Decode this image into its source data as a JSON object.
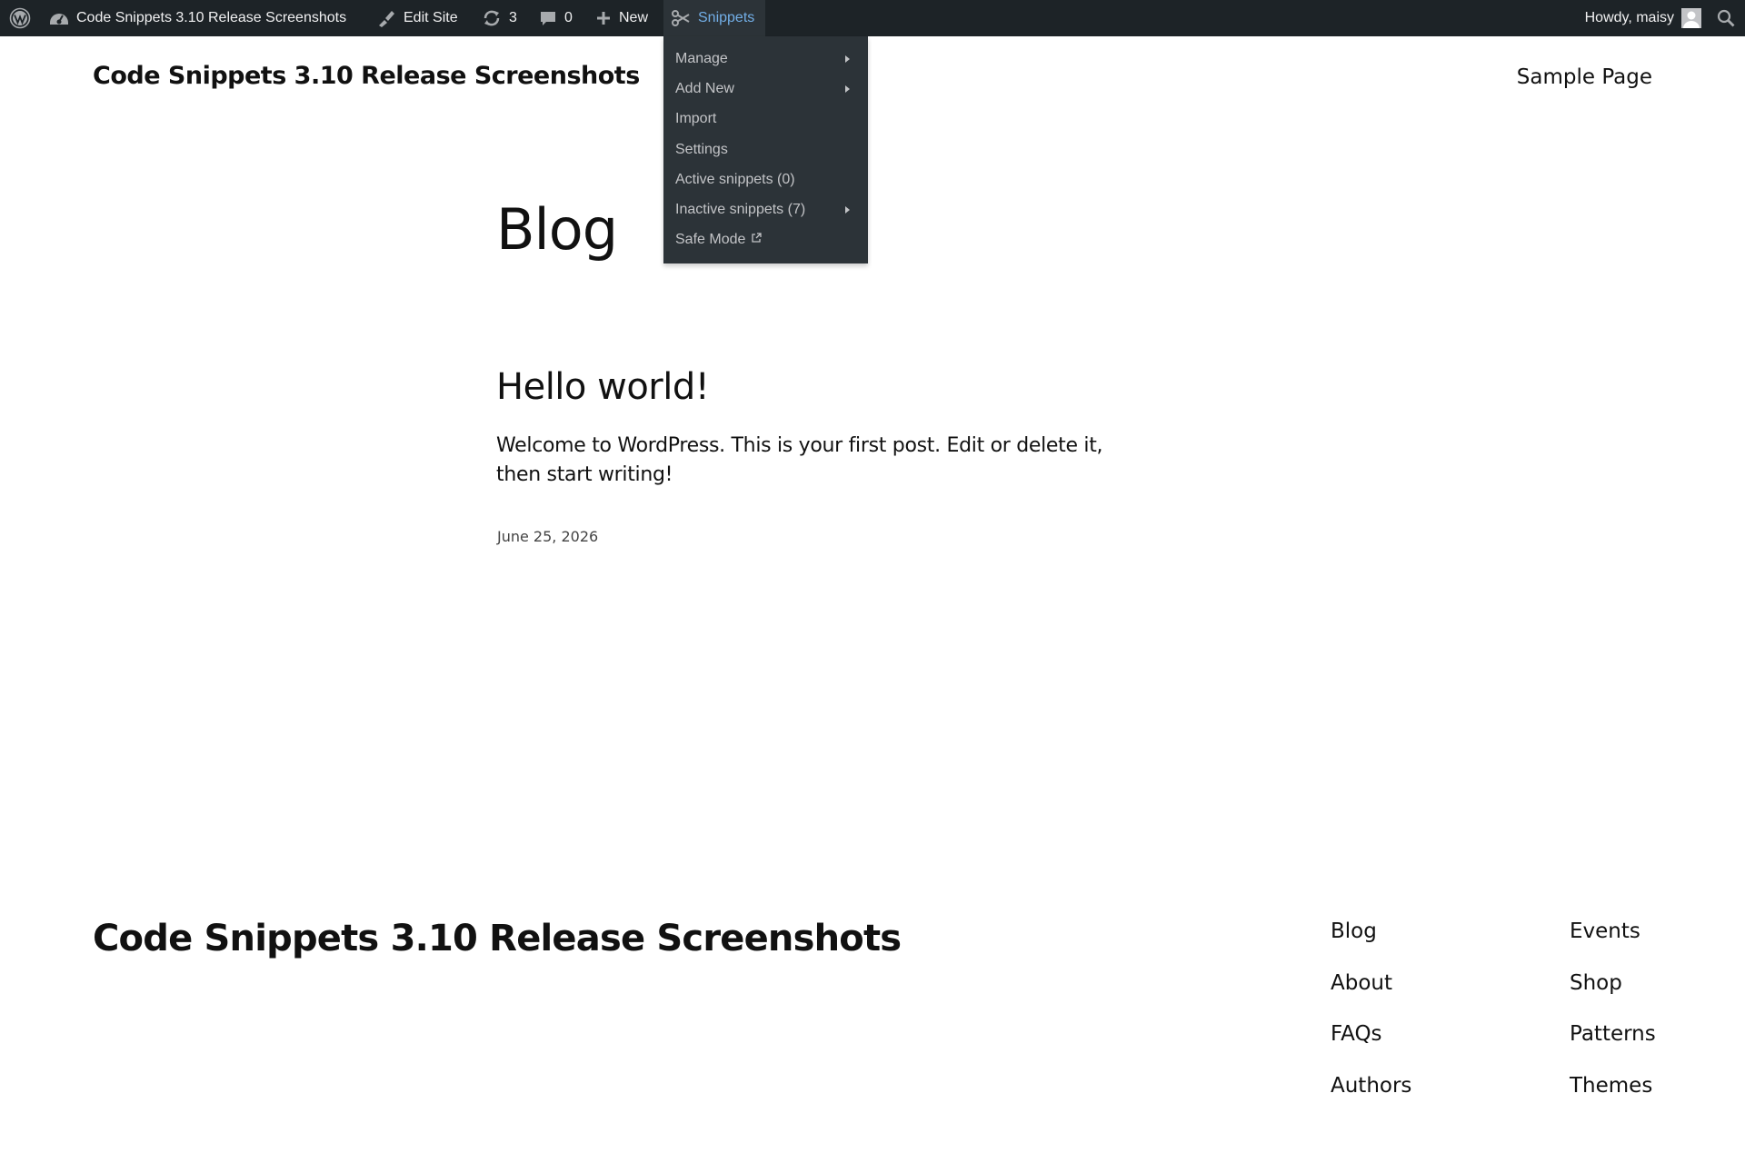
{
  "admin_bar": {
    "site_name": "Code Snippets 3.10 Release Screenshots",
    "edit_site": "Edit Site",
    "updates_count": "3",
    "comments_count": "0",
    "new_label": "New",
    "snippets_label": "Snippets",
    "howdy": "Howdy, maisy"
  },
  "snippets_menu": {
    "items": [
      {
        "label": "Manage"
      },
      {
        "label": "Add New"
      },
      {
        "label": "Import"
      },
      {
        "label": "Settings"
      },
      {
        "label": "Active snippets (0)"
      },
      {
        "label": "Inactive snippets (7)"
      },
      {
        "label": "Safe Mode"
      }
    ]
  },
  "header": {
    "site_title": "Code Snippets 3.10 Release Screenshots",
    "nav": [
      "Sample Page"
    ]
  },
  "main": {
    "heading": "Blog",
    "post": {
      "title": "Hello world!",
      "excerpt": "Welcome to WordPress. This is your first post. Edit or delete it, then start writing!",
      "date": "June 25, 2026"
    }
  },
  "footer": {
    "title": "Code Snippets 3.10 Release Screenshots",
    "col1": [
      "Blog",
      "About",
      "FAQs",
      "Authors"
    ],
    "col2": [
      "Events",
      "Shop",
      "Patterns",
      "Themes"
    ]
  },
  "colors": {
    "admin_bar_bg": "#1d2327",
    "submenu_bg": "#2c3338",
    "accent": "#72aee6"
  }
}
